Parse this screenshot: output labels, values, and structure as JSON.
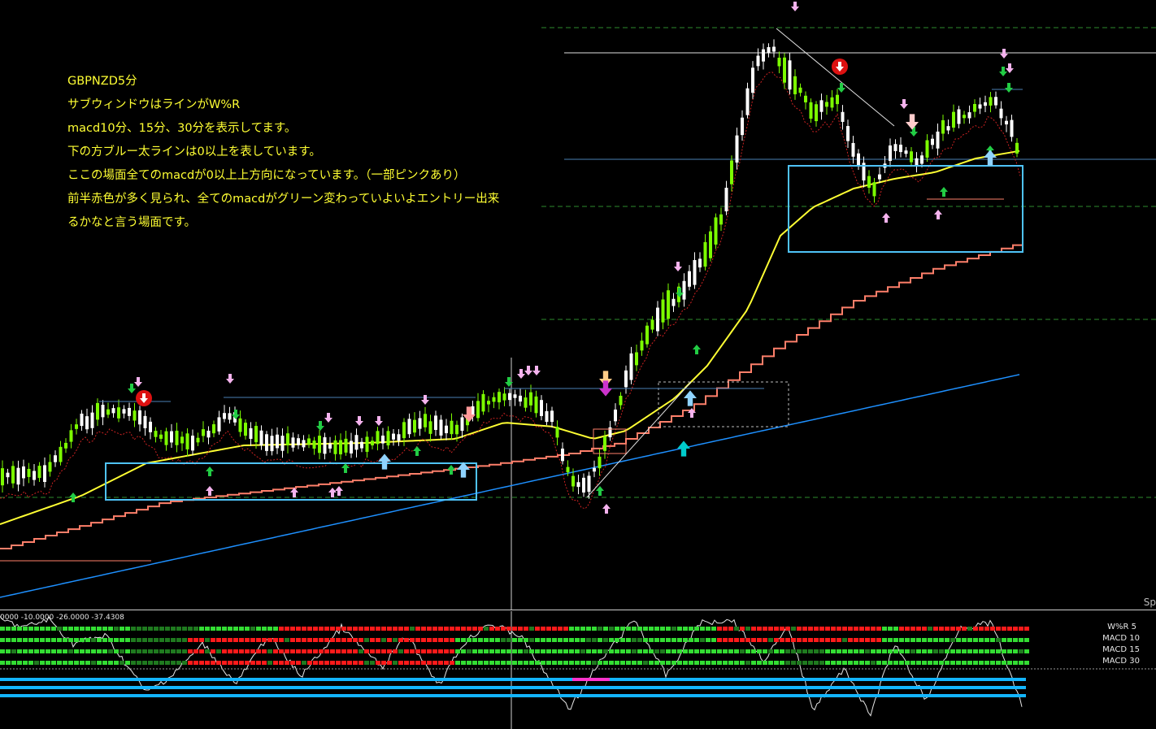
{
  "chart": {
    "note_lines": [
      "GBPNZD5分",
      "サブウィンドウはラインがW%R",
      "macd10分、15分、30分を表示してます。",
      "下の方ブルー太ラインは0以上を表しています。",
      "ここの場面全てのmacdが0以上上方向になっています。（一部ピンクあり）",
      "前半赤色が多く見られ、全てのmacdがグリーン変わっていよいよエントリー出来",
      "るかなと言う場面です。"
    ],
    "corner_label": "Sp"
  },
  "subwindow": {
    "values_text": "0000 -10.0000 -26.0000 -37.4308",
    "rows": [
      {
        "label": "W%R  5"
      },
      {
        "label": "MACD  10"
      },
      {
        "label": "MACD  15"
      },
      {
        "label": "MACD  30"
      }
    ]
  },
  "colors": {
    "background": "#000000",
    "bull_candle": "#7CFC00",
    "bear_candle": "#ffffff",
    "ma_fast": "#ffff33",
    "ma_step": "#ff7f6a",
    "ma_slow": "#1e90ff",
    "box": "#4fc3f7",
    "arrow_green": "#22cc44",
    "arrow_pink": "#f5b3ee",
    "macd_green": "#33dd33",
    "macd_red": "#ff1a1a",
    "macd_dark": "#1f7a1f",
    "zero_line": "#13b5ff",
    "zero_line_pink": "#ff33cc"
  }
}
